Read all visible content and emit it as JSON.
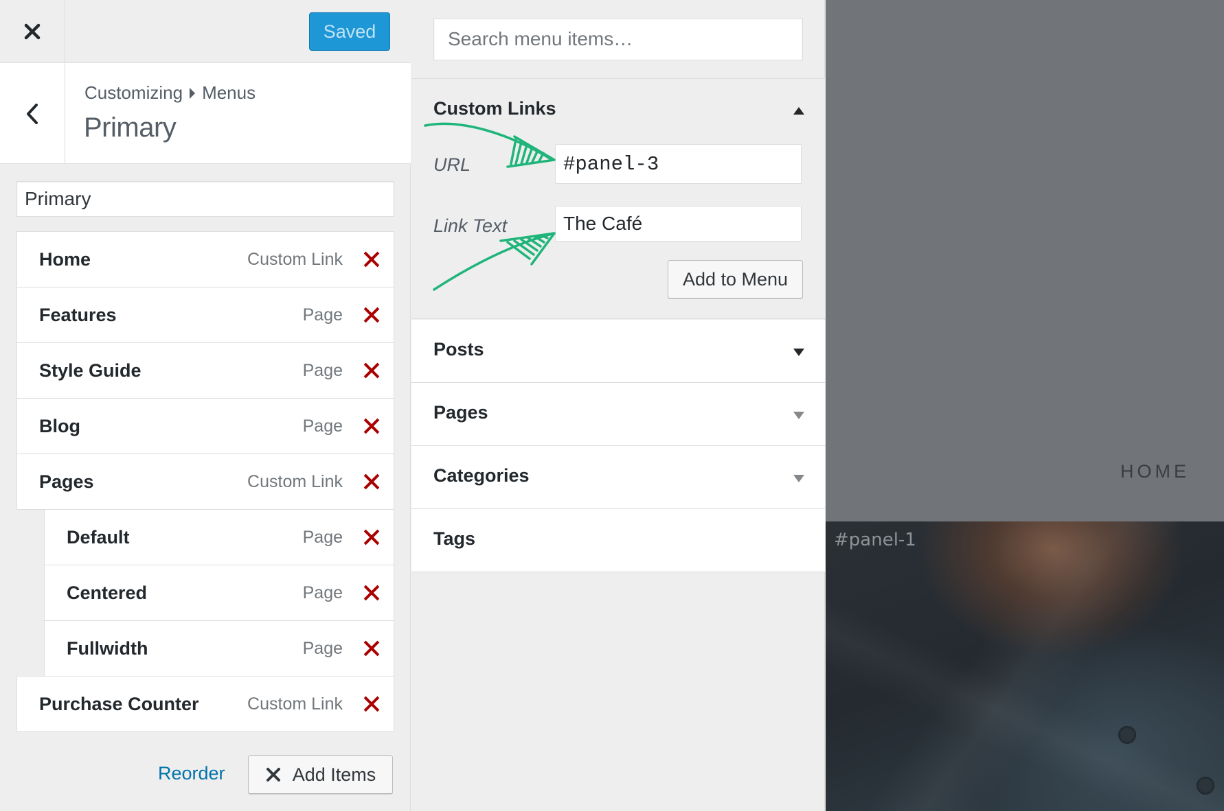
{
  "topbar": {
    "close_icon": "close-icon",
    "saved_label": "Saved",
    "saved_color": "#1e97d6"
  },
  "header": {
    "back_icon": "chevron-left-icon",
    "breadcrumb": {
      "root": "Customizing",
      "current": "Menus"
    },
    "title": "Primary"
  },
  "menu": {
    "name_value": "Primary",
    "items": [
      {
        "title": "Home",
        "type": "Custom Link",
        "child": false
      },
      {
        "title": "Features",
        "type": "Page",
        "child": false
      },
      {
        "title": "Style Guide",
        "type": "Page",
        "child": false
      },
      {
        "title": "Blog",
        "type": "Page",
        "child": false
      },
      {
        "title": "Pages",
        "type": "Custom Link",
        "child": false
      },
      {
        "title": "Default",
        "type": "Page",
        "child": true
      },
      {
        "title": "Centered",
        "type": "Page",
        "child": true
      },
      {
        "title": "Fullwidth",
        "type": "Page",
        "child": true
      },
      {
        "title": "Purchase Counter",
        "type": "Custom Link",
        "child": false
      }
    ],
    "reorder_label": "Reorder",
    "add_items_label": "Add Items",
    "remove_color": "#aa0000"
  },
  "available": {
    "search_placeholder": "Search menu items…",
    "custom_links": {
      "title": "Custom Links",
      "url_label": "URL",
      "url_value": "#panel-3",
      "link_text_label": "Link Text",
      "link_text_value": "The Café",
      "add_button": "Add to Menu",
      "annotation_color": "#1fb57a"
    },
    "sections": [
      "Posts",
      "Pages",
      "Categories",
      "Tags"
    ]
  },
  "preview": {
    "nav_label": "HOME",
    "panel_label": "#panel-1"
  }
}
